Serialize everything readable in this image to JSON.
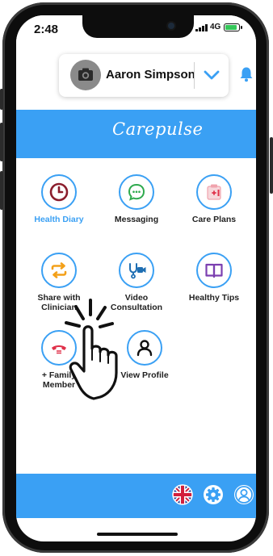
{
  "status": {
    "time": "2:48",
    "network": "4G",
    "battery_level": 0.85
  },
  "user": {
    "name": "Aaron Simpson",
    "avatar_icon": "camera-icon",
    "dropdown_icon": "chevron-down-icon"
  },
  "header": {
    "notification_icon": "bell-icon"
  },
  "banner": {
    "logo_text": "Carepulse"
  },
  "menu": [
    {
      "label": "Health Diary",
      "icon": "clock-icon",
      "active": true
    },
    {
      "label": "Messaging",
      "icon": "chat-icon",
      "active": false
    },
    {
      "label": "Care Plans",
      "icon": "care-plan-icon",
      "active": false
    },
    {
      "label": "Share with Clinician",
      "line1": "Share with",
      "line2": "Clinician",
      "icon": "share-arrows-icon",
      "active": false
    },
    {
      "label": "Video Consultation",
      "line1": "Video",
      "line2": "Consultation",
      "icon": "video-stethoscope-icon",
      "active": false
    },
    {
      "label": "Healthy Tips",
      "icon": "book-icon",
      "active": false
    },
    {
      "label": "+ Family Member",
      "line1": "+ Family",
      "line2": "Member",
      "icon": "family-phone-icon",
      "active": false
    },
    {
      "label": "View Profile",
      "icon": "person-icon",
      "active": false
    }
  ],
  "footer": {
    "icons": [
      "uk-flag-icon",
      "settings-icon",
      "account-icon"
    ]
  },
  "colors": {
    "accent": "#3aa0f4",
    "active_label": "#3aa0f4"
  }
}
